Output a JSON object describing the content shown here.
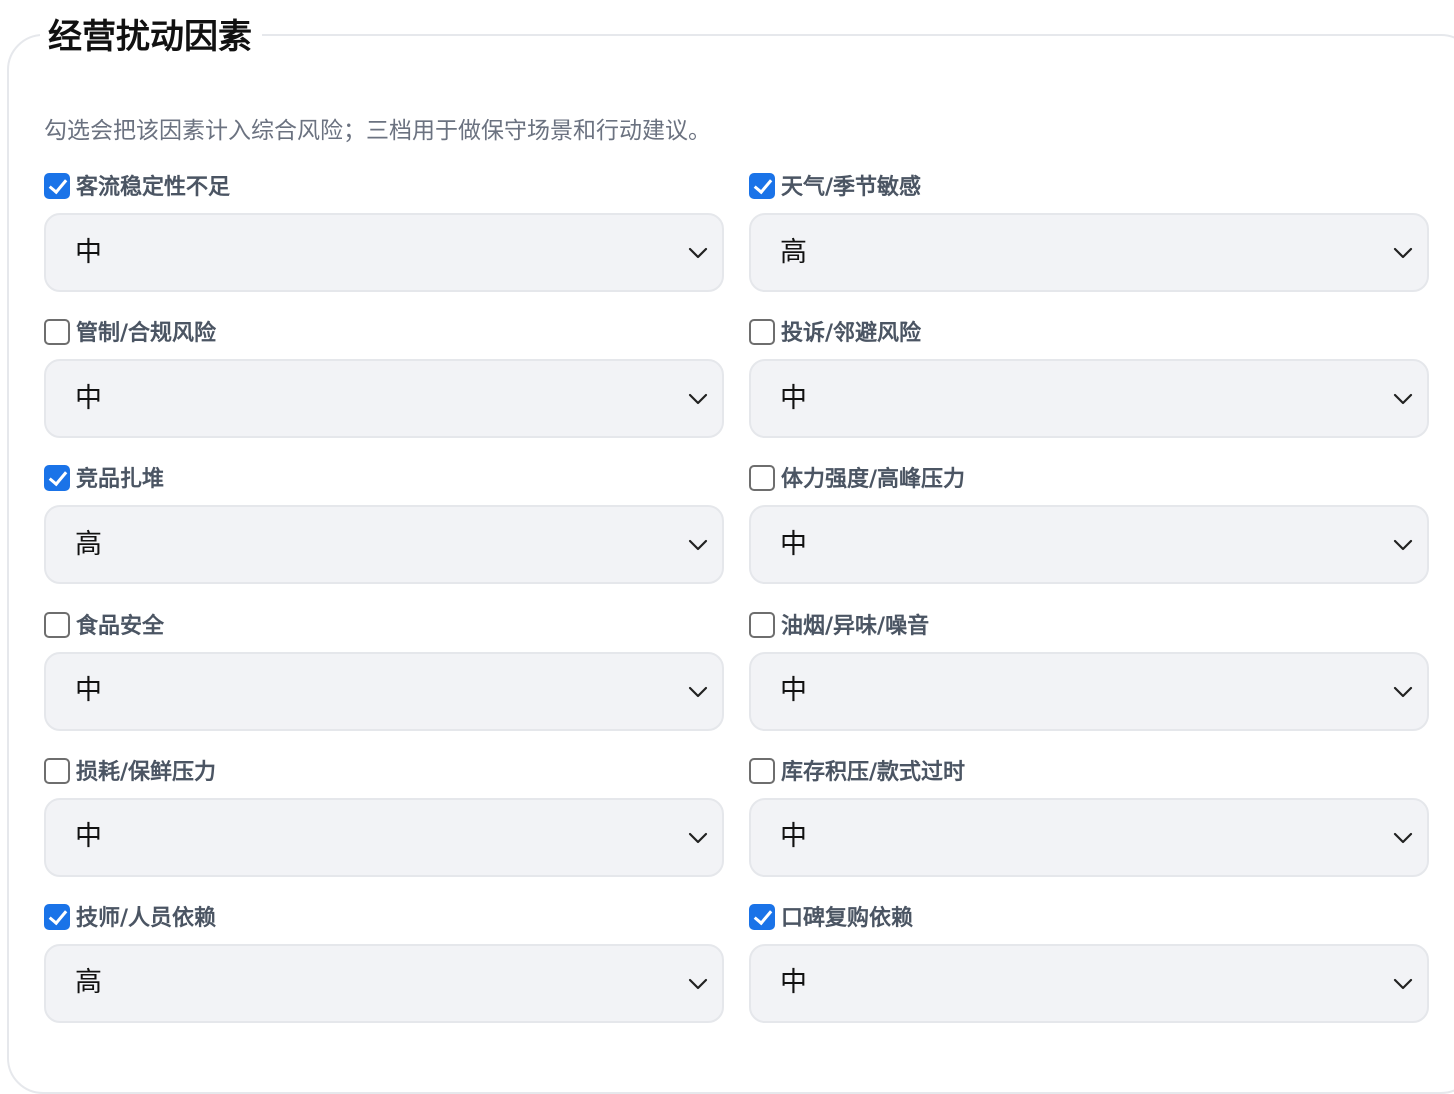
{
  "section": {
    "title": "经营扰动因素",
    "hint": "勾选会把该因素计入综合风险；三档用于做保守场景和行动建议。"
  },
  "factors": [
    {
      "label": "客流稳定性不足",
      "checked": true,
      "level": "中"
    },
    {
      "label": "天气/季节敏感",
      "checked": true,
      "level": "高"
    },
    {
      "label": "管制/合规风险",
      "checked": false,
      "level": "中"
    },
    {
      "label": "投诉/邻避风险",
      "checked": false,
      "level": "中"
    },
    {
      "label": "竞品扎堆",
      "checked": true,
      "level": "高"
    },
    {
      "label": "体力强度/高峰压力",
      "checked": false,
      "level": "中"
    },
    {
      "label": "食品安全",
      "checked": false,
      "level": "中"
    },
    {
      "label": "油烟/异味/噪音",
      "checked": false,
      "level": "中"
    },
    {
      "label": "损耗/保鲜压力",
      "checked": false,
      "level": "中"
    },
    {
      "label": "库存积压/款式过时",
      "checked": false,
      "level": "中"
    },
    {
      "label": "技师/人员依赖",
      "checked": true,
      "level": "高"
    },
    {
      "label": "口碑复购依赖",
      "checked": true,
      "level": "中"
    }
  ],
  "icons": {
    "checkbox": "checkbox-icon",
    "dropdown": "chevron-down-icon"
  },
  "colors": {
    "accent": "#1a73e8",
    "select_bg": "#f2f3f6",
    "label": "#4b5563",
    "hint": "#6b7280"
  }
}
